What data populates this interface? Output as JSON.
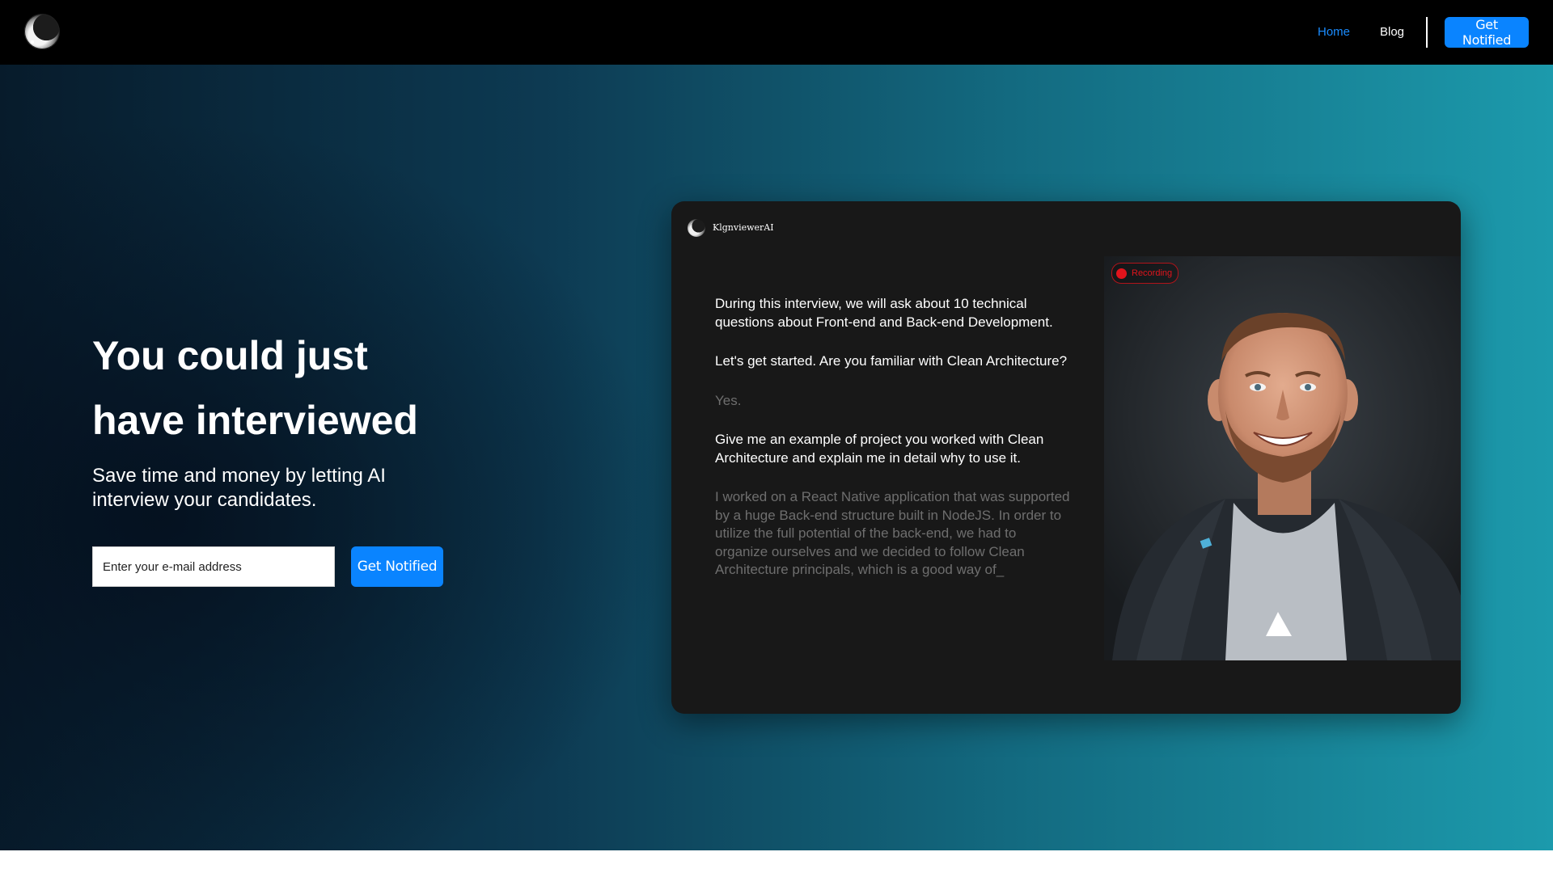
{
  "nav": {
    "logo_icon": "moon-logo-icon",
    "links": [
      {
        "label": "Home",
        "active": true,
        "color": "#1a8cff"
      },
      {
        "label": "Blog",
        "active": false,
        "color": "#ffffff"
      }
    ],
    "cta_label": "Get Notified"
  },
  "hero": {
    "title_line1": "You could just",
    "title_line2": "have interviewed",
    "subtitle": "Save time and money by letting AI interview your candidates.",
    "email_placeholder": "Enter your e-mail address",
    "cta_label": "Get Notified"
  },
  "mockup": {
    "brand": "KlgnviewerAI",
    "recording_label": "Recording",
    "messages": [
      {
        "role": "ai",
        "text": "During this interview, we will ask about 10 technical questions about Front-end and Back-end Development."
      },
      {
        "role": "ai",
        "text": "Let's get started. Are you familiar with Clean Architecture?"
      },
      {
        "role": "user",
        "text": "Yes."
      },
      {
        "role": "ai",
        "text": "Give me an example of project you worked with Clean Architecture and explain me in detail why to use it."
      },
      {
        "role": "user",
        "text": "I worked on a React Native application that  was supported by a huge Back-end structure built in NodeJS. In order to utilize the full potential of the back-end, we had to organize ourselves and we decided to follow Clean Architecture principals, which is a good way of_"
      }
    ]
  },
  "colors": {
    "accent": "#0a84ff",
    "recording": "#e0141c",
    "card_bg": "#181818"
  }
}
